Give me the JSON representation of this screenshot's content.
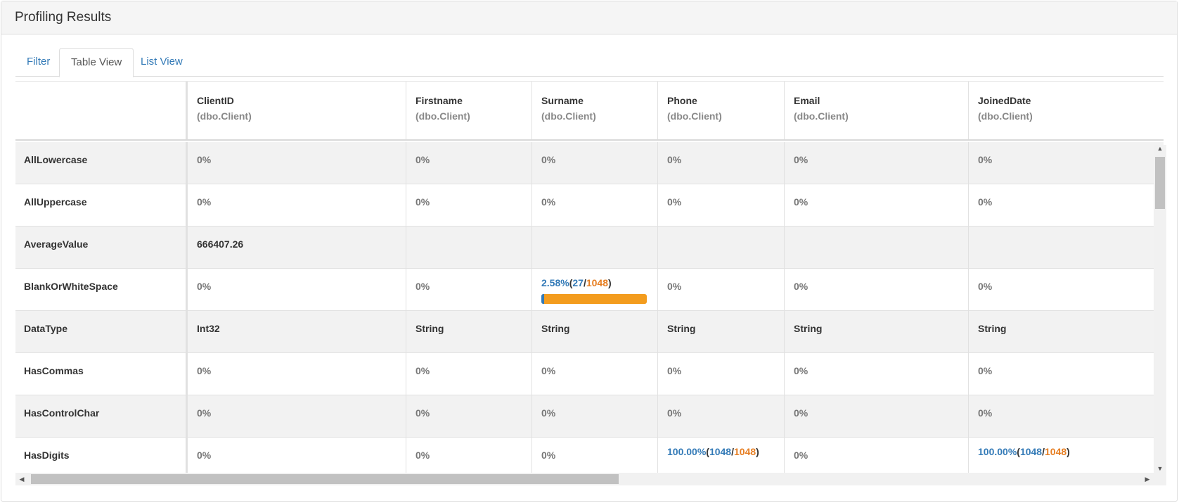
{
  "panel": {
    "title": "Profiling Results"
  },
  "tabs": [
    {
      "label": "Filter",
      "active": false
    },
    {
      "label": "Table View",
      "active": true
    },
    {
      "label": "List View",
      "active": false
    }
  ],
  "columns": [
    {
      "name": "ClientID",
      "table": "(dbo.Client)"
    },
    {
      "name": "Firstname",
      "table": "(dbo.Client)"
    },
    {
      "name": "Surname",
      "table": "(dbo.Client)"
    },
    {
      "name": "Phone",
      "table": "(dbo.Client)"
    },
    {
      "name": "Email",
      "table": "(dbo.Client)"
    },
    {
      "name": "JoinedDate",
      "table": "(dbo.Client)"
    }
  ],
  "rows": [
    {
      "metric": "AllLowercase",
      "values": [
        "0%",
        "0%",
        "0%",
        "0%",
        "0%",
        "0%"
      ]
    },
    {
      "metric": "AllUppercase",
      "values": [
        "0%",
        "0%",
        "0%",
        "0%",
        "0%",
        "0%"
      ]
    },
    {
      "metric": "AverageValue",
      "values": [
        "666407.26",
        "",
        "",
        "",
        "",
        ""
      ]
    },
    {
      "metric": "BlankOrWhiteSpace",
      "values": [
        "0%",
        "0%",
        "",
        "0%",
        "0%",
        "0%"
      ],
      "surname_stat": {
        "pct": "2.58%",
        "count": "27",
        "total": "1048",
        "fraction": 0.0258
      }
    },
    {
      "metric": "DataType",
      "values": [
        "Int32",
        "String",
        "String",
        "String",
        "String",
        "String"
      ]
    },
    {
      "metric": "HasCommas",
      "values": [
        "0%",
        "0%",
        "0%",
        "0%",
        "0%",
        "0%"
      ]
    },
    {
      "metric": "HasControlChar",
      "values": [
        "0%",
        "0%",
        "0%",
        "0%",
        "0%",
        "0%"
      ]
    },
    {
      "metric": "HasDigits",
      "values": [
        "0%",
        "0%",
        "0%",
        "",
        "0%",
        ""
      ],
      "phone_stat": {
        "pct": "100.00%",
        "count": "1048",
        "total": "1048"
      },
      "joined_stat": {
        "pct": "100.00%",
        "count": "1048",
        "total": "1048"
      }
    }
  ],
  "colors": {
    "link": "#337ab7",
    "total": "#e67e22",
    "bar": "#f39c1e"
  }
}
